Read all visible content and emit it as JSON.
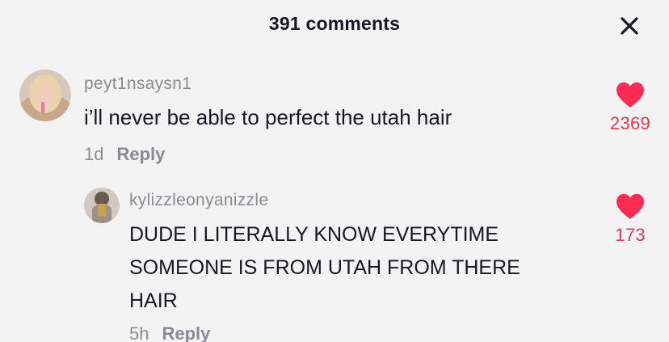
{
  "header": {
    "title": "391 comments",
    "close_icon": "close-icon"
  },
  "colors": {
    "background": "#f3f3f3",
    "like": "#fe2c55",
    "like_count": "#e8364f",
    "muted": "#8a8b91",
    "text": "#161823"
  },
  "comments": [
    {
      "username": "peyt1nsaysn1",
      "text": "i’ll never be able to perfect the utah hair",
      "time": "1d",
      "reply_label": "Reply",
      "likes": "2369",
      "like_icon": "heart-icon",
      "avatar_icon": "user-avatar-photo"
    },
    {
      "username": "kylizzleonyanizzle",
      "text_lines": [
        "DUDE I LITERALLY KNOW EVERYTIME",
        "SOMEONE IS FROM UTAH FROM THERE",
        "HAIR"
      ],
      "time": "5h",
      "reply_label": "Reply",
      "likes": "173",
      "like_icon": "heart-icon",
      "avatar_icon": "user-avatar-photo"
    }
  ]
}
